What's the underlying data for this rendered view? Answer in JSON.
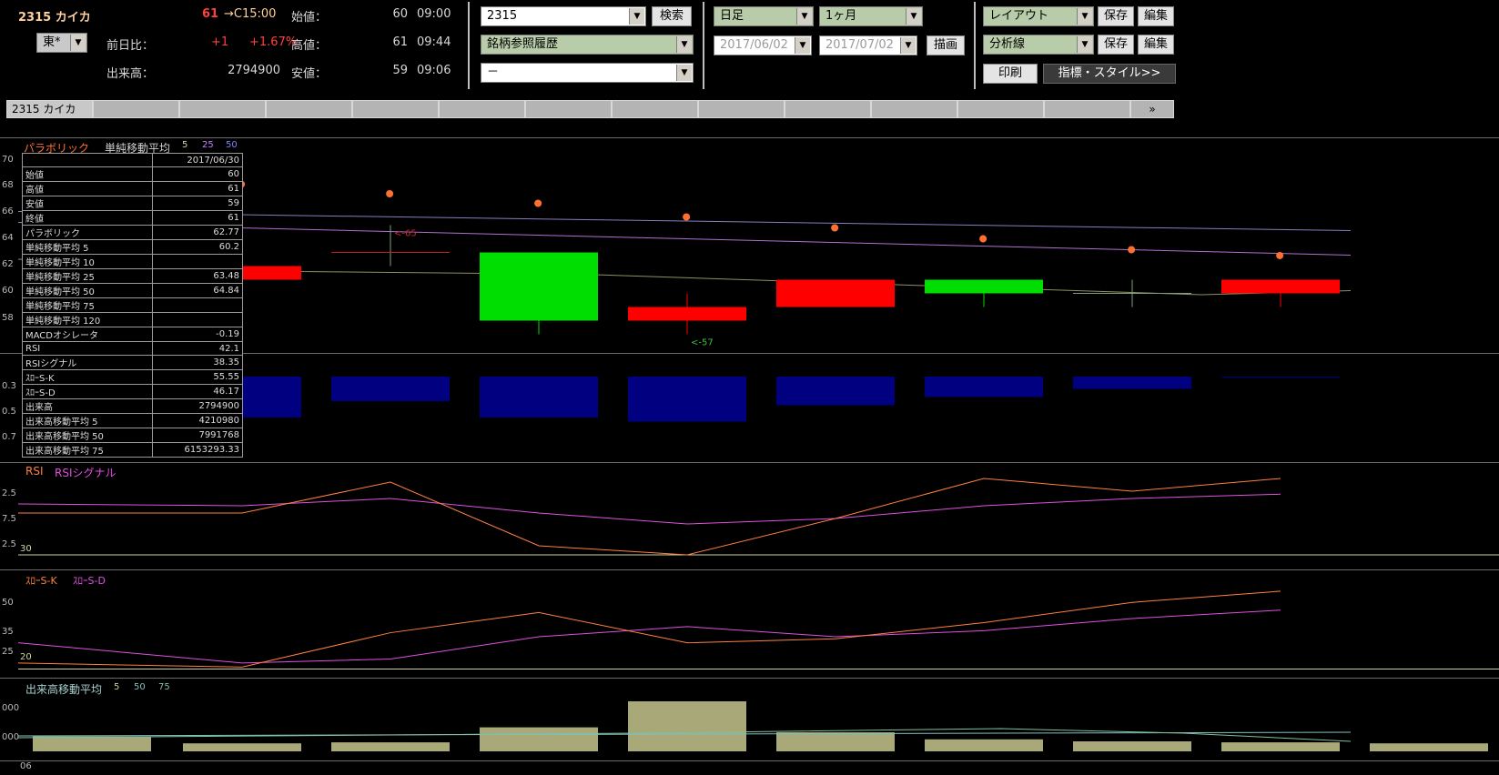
{
  "quote": {
    "code_name": "2315 カイカ",
    "price": "61",
    "arrow_time": "→C15:00",
    "open_label": "始値：",
    "open_value": "60",
    "open_time": "09:00",
    "high_label": "高値：",
    "high_value": "61",
    "high_time": "09:44",
    "low_label": "安値：",
    "low_value": "59",
    "low_time": "09:06",
    "market": "東*",
    "change_label": "前日比：",
    "change_value": "+1",
    "change_pct": "+1.67%",
    "volume_label": "出来高：",
    "volume_value": "2794900"
  },
  "search": {
    "code_value": "2315",
    "search_button": "検索",
    "history_select": "銘柄参照履歴",
    "third_select": "－"
  },
  "period": {
    "bar_type": "日足",
    "range": "1ヶ月",
    "date_from": "2017/06/02",
    "date_to": "2017/07/02",
    "draw_button": "描画"
  },
  "layout": {
    "layout_select": "レイアウト",
    "save_label": "保存",
    "edit_label": "編集",
    "analysis_select": "分析線",
    "save2_label": "保存",
    "edit2_label": "編集",
    "print_button": "印刷",
    "style_button": "指標・スタイル>>"
  },
  "tabs": {
    "active": "2315 カイカ",
    "more": "»"
  },
  "panels": {
    "price_title": "パラボリック",
    "sma_title": "単純移動平均",
    "sma_periods": [
      "5",
      "25",
      "50"
    ],
    "price_y_ticks": [
      "70",
      "68",
      "66",
      "64",
      "62",
      "60",
      "58"
    ],
    "hi_marker": "<-65",
    "lo_marker": "<-57",
    "macd_y_ticks": [
      "0.3",
      "0.5",
      "0.7"
    ],
    "rsi_title": "RSI",
    "rsi_signal_title": "RSIシグナル",
    "rsi_y_ticks": [
      "2.5",
      "7.5",
      "2.5"
    ],
    "rsi_level": "30",
    "stoch_k_title": "ｽﾛｰS-K",
    "stoch_d_title": "ｽﾛｰS-D",
    "stoch_y_ticks": [
      "50",
      "35",
      "25"
    ],
    "stoch_level": "20",
    "vol_title": "出来高移動平均",
    "vol_periods": [
      "5",
      "50",
      "75"
    ],
    "vol_y_ticks": [
      "000",
      "000"
    ],
    "bottom_label": "06"
  },
  "info_table": {
    "date": "2017/06/30",
    "rows": [
      [
        "始値",
        "60"
      ],
      [
        "高値",
        "61"
      ],
      [
        "安値",
        "59"
      ],
      [
        "終値",
        "61"
      ],
      [
        "パラボリック",
        "62.77"
      ],
      [
        "単純移動平均 5",
        "60.2"
      ],
      [
        "単純移動平均 10",
        ""
      ],
      [
        "単純移動平均 25",
        "63.48"
      ],
      [
        "単純移動平均 50",
        "64.84"
      ],
      [
        "単純移動平均 75",
        ""
      ],
      [
        "単純移動平均 120",
        ""
      ],
      [
        "MACDオシレータ",
        "-0.19"
      ],
      [
        "RSI",
        "42.1"
      ],
      [
        "RSIシグナル",
        "38.35"
      ],
      [
        "ｽﾛｰS-K",
        "55.55"
      ],
      [
        "ｽﾛｰS-D",
        "46.17"
      ],
      [
        "出来高",
        "2794900"
      ],
      [
        "出来高移動平均 5",
        "4210980"
      ],
      [
        "出来高移動平均 50",
        "7991768"
      ],
      [
        "出来高移動平均 75",
        "6153293.33"
      ]
    ]
  },
  "colors": {
    "up": "#ff0000",
    "down": "#00dd00",
    "macd": "#000080",
    "volume": "#a8a878",
    "rsi": "#ff8040",
    "signal": "#e050e0",
    "parabolic": "#ff7030"
  },
  "chart_data": {
    "type": "candlestick",
    "candles": [
      {
        "open": 61,
        "high": 61,
        "low": 61,
        "close": 61
      },
      {
        "open": 61,
        "high": 63,
        "low": 61,
        "close": 62
      },
      {
        "open": 63,
        "high": 65,
        "low": 62,
        "close": 63
      },
      {
        "open": 63,
        "high": 63,
        "low": 57,
        "close": 58
      },
      {
        "open": 58,
        "high": 60,
        "low": 57,
        "close": 59
      },
      {
        "open": 59,
        "high": 61,
        "low": 59,
        "close": 61
      },
      {
        "open": 61,
        "high": 61,
        "low": 59,
        "close": 60
      },
      {
        "open": 60,
        "high": 61,
        "low": 59,
        "close": 60
      },
      {
        "open": 60,
        "high": 61,
        "low": 59,
        "close": 61
      }
    ],
    "parabolic": [
      68.5,
      68,
      67.3,
      66.6,
      65.6,
      64.8,
      64,
      63.2,
      62.77
    ],
    "price_ylim": [
      56.5,
      70.5
    ],
    "macd": [
      -0.8,
      -0.5,
      -0.3,
      -0.5,
      -0.55,
      -0.35,
      -0.25,
      -0.15,
      -0.01
    ],
    "rsi": [
      28,
      28,
      45,
      10,
      5,
      25,
      47,
      40,
      47
    ],
    "rsi_signal": [
      33,
      32,
      36,
      28,
      22,
      25,
      32,
      36,
      38.35
    ],
    "stoch_k": [
      20,
      18,
      35,
      45,
      30,
      32,
      40,
      50,
      55.55
    ],
    "stoch_d": [
      30,
      20,
      22,
      33,
      38,
      33,
      36,
      42,
      46.17
    ],
    "volume": [
      1.5,
      0.8,
      0.9,
      2.4,
      5.0,
      1.9,
      1.2,
      1.0,
      0.9,
      0.8
    ]
  }
}
